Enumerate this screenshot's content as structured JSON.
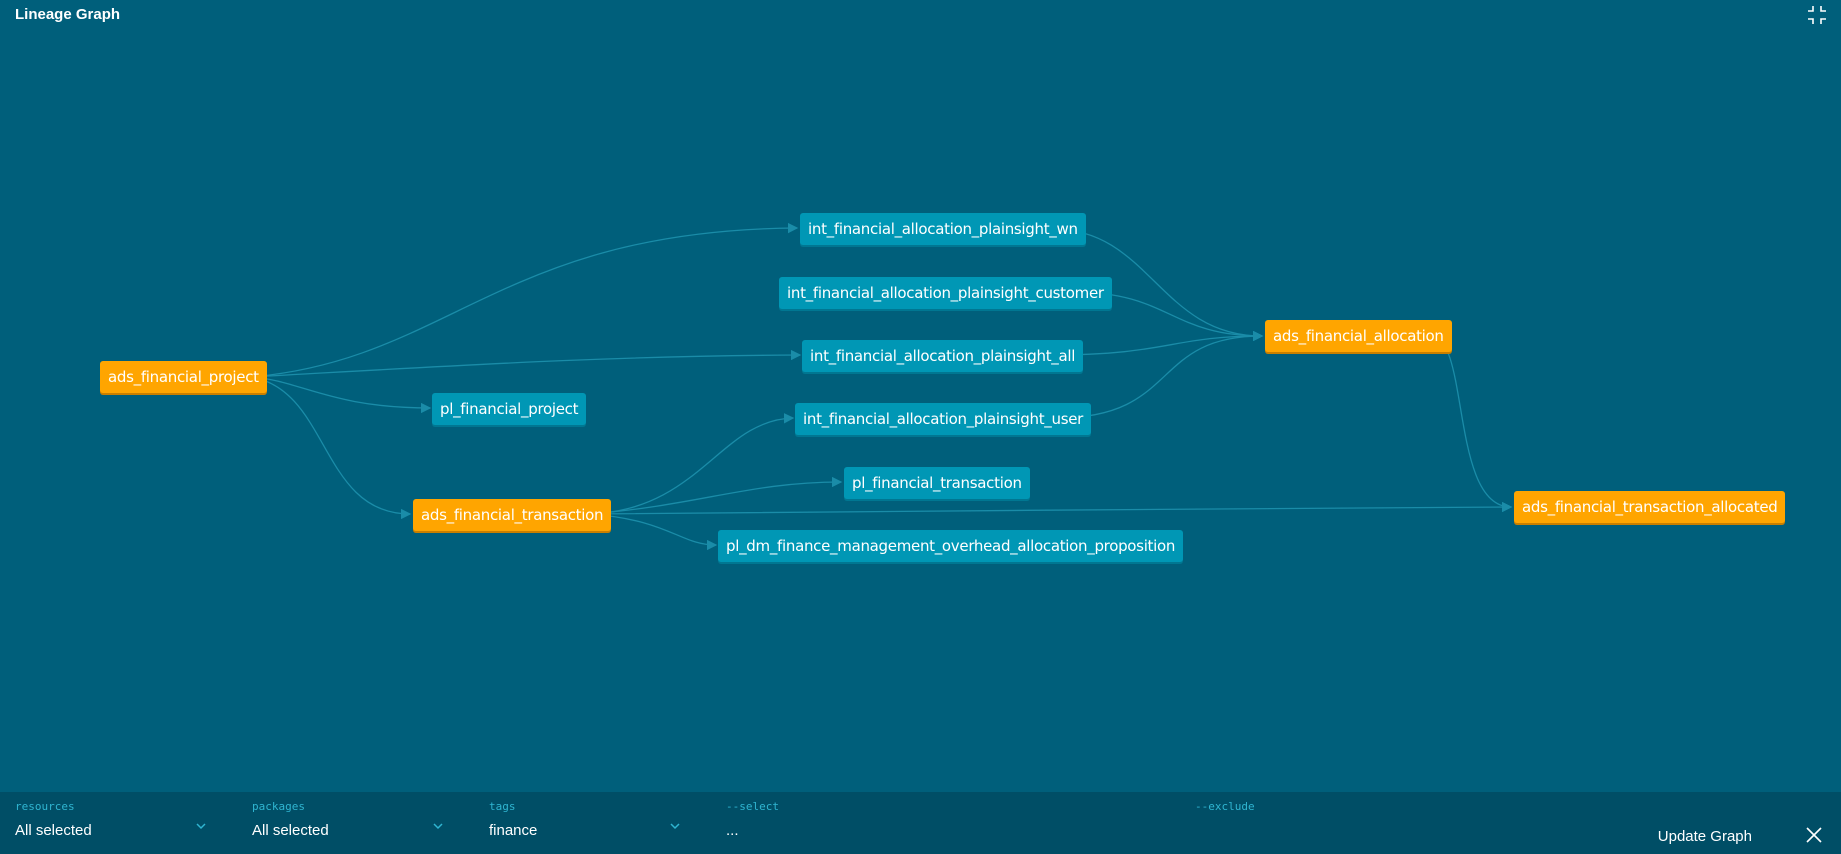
{
  "header": {
    "title": "Lineage Graph",
    "fullscreen_icon": "collapse-icon"
  },
  "colors": {
    "background": "#005f7b",
    "model_node": "#0097b5",
    "source_node": "#ffa500",
    "edge": "#1a8ca8",
    "toolbar_bg": "#004e66",
    "toolbar_label": "#2fb5d1"
  },
  "graph": {
    "nodes": {
      "ads_financial_project": "ads_financial_project",
      "pl_financial_project": "pl_financial_project",
      "ads_financial_transaction": "ads_financial_transaction",
      "int_wn": "int_financial_allocation_plainsight_wn",
      "int_customer": "int_financial_allocation_plainsight_customer",
      "int_all": "int_financial_allocation_plainsight_all",
      "int_user": "int_financial_allocation_plainsight_user",
      "pl_financial_transaction": "pl_financial_transaction",
      "pl_dm_overhead": "pl_dm_finance_management_overhead_allocation_proposition",
      "ads_financial_allocation": "ads_financial_allocation",
      "ads_transaction_allocated": "ads_financial_transaction_allocated"
    }
  },
  "toolbar": {
    "resources": {
      "label": "resources",
      "value": "All selected"
    },
    "packages": {
      "label": "packages",
      "value": "All selected"
    },
    "tags": {
      "label": "tags",
      "value": "finance"
    },
    "select": {
      "label": "--select",
      "value": "..."
    },
    "exclude": {
      "label": "--exclude",
      "value": ""
    },
    "update_label": "Update Graph",
    "close_icon": "close-icon"
  }
}
